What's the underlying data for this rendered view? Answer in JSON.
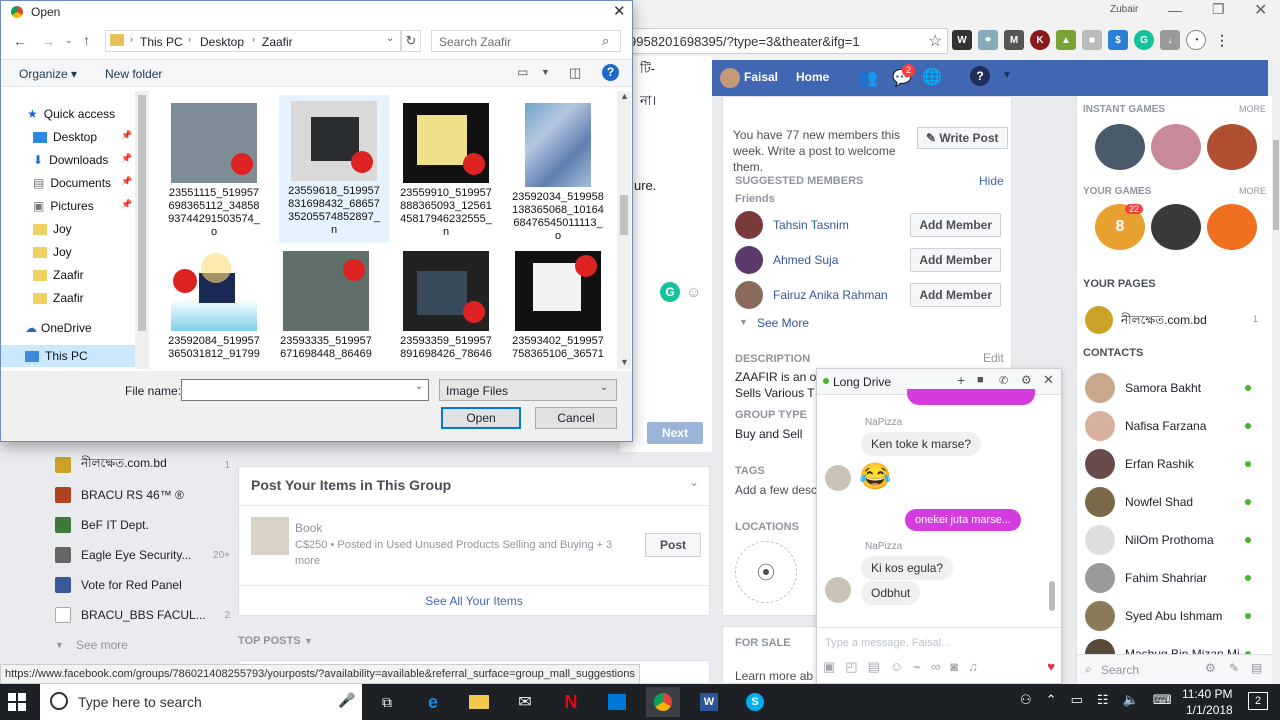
{
  "browser": {
    "user_name": "Zubair",
    "url": "9958201698395/?type=3&theater&ifg=1",
    "status_url": "https://www.facebook.com/groups/786021408255793/yourposts/?availability=available&referral_surface=group_mall_suggestions"
  },
  "dialog": {
    "title": "Open",
    "breadcrumb": [
      "This PC",
      "Desktop",
      "Zaafir"
    ],
    "search_placeholder": "Search Zaafir",
    "organize_label": "Organize",
    "new_folder_label": "New folder",
    "nav_items": [
      {
        "label": "Quick access",
        "icon": "star-icon"
      },
      {
        "label": "Desktop",
        "icon": "desktop-icon"
      },
      {
        "label": "Downloads",
        "icon": "download-icon"
      },
      {
        "label": "Documents",
        "icon": "document-icon"
      },
      {
        "label": "Pictures",
        "icon": "pictures-icon"
      },
      {
        "label": "Joy",
        "icon": "folder-icon"
      },
      {
        "label": "Joy",
        "icon": "folder-icon"
      },
      {
        "label": "Zaafir",
        "icon": "folder-icon"
      },
      {
        "label": "Zaafir",
        "icon": "folder-icon"
      },
      {
        "label": "OneDrive",
        "icon": "cloud-icon"
      },
      {
        "label": "This PC",
        "icon": "computer-icon"
      }
    ],
    "files": [
      {
        "name": "23551115_519957698365112_3485893744291503574_o",
        "lines": [
          "23551115_519957",
          "698365112_34858",
          "93744291503574_",
          "o"
        ]
      },
      {
        "name": "23559618_519957831698432_6865735205574852897_n",
        "lines": [
          "23559618_519957",
          "831698432_68657",
          "35205574852897_",
          "n"
        ]
      },
      {
        "name": "23559910_519957888365093_1256145817946232555_n",
        "lines": [
          "23559910_519957",
          "888365093_12561",
          "45817946232555_",
          "n"
        ]
      },
      {
        "name": "23592034_519958138365068_1016468476545011113_o",
        "lines": [
          "23592034_519958",
          "138365068_10164",
          "68476545011113_",
          "o"
        ]
      },
      {
        "name": "23592084_519957365031812_91799",
        "lines": [
          "23592084_519957",
          "365031812_91799"
        ]
      },
      {
        "name": "23593335_519957671698448_86469",
        "lines": [
          "23593335_519957",
          "671698448_86469"
        ]
      },
      {
        "name": "23593359_519957891698426_78646",
        "lines": [
          "23593359_519957",
          "891698426_78646"
        ]
      },
      {
        "name": "23593402_519957758365106_36571",
        "lines": [
          "23593402_519957",
          "758365106_36571"
        ]
      }
    ],
    "file_name_label": "File name:",
    "file_name_value": "",
    "file_type": "Image Files",
    "open_label": "Open",
    "cancel_label": "Cancel"
  },
  "facebook": {
    "nav": {
      "profile": "Faisal",
      "home": "Home",
      "badge": "2"
    },
    "new_members_text": "You have 77 new members this week. Write a post to welcome them.",
    "write_post": "Write Post",
    "suggested_members": "SUGGESTED MEMBERS",
    "hide": "Hide",
    "friends": "Friends",
    "members": [
      "Tahsin Tasnim",
      "Ahmed Suja",
      "Fairuz Anika Rahman"
    ],
    "add_member": "Add Member",
    "see_more": "See More",
    "description": "DESCRIPTION",
    "edit": "Edit",
    "description_text": "ZAAFIR is an o",
    "description_text2": "Sells Various T",
    "group_type_label": "GROUP TYPE",
    "group_type": "Buy and Sell",
    "tags": "TAGS",
    "add_desc": "Add a few desc",
    "locations": "LOCATIONS",
    "for_sale": "FOR SALE",
    "learn_more": "Learn more ab",
    "next": "Next",
    "instant_games": "INSTANT GAMES",
    "more": "MORE",
    "your_games": "YOUR GAMES",
    "game_badge": "22",
    "your_pages": "YOUR PAGES",
    "page_name": "নীলক্ষেত.com.bd",
    "page_count": "1",
    "contacts_label": "CONTACTS",
    "contacts": [
      "Samora Bakht",
      "Nafisa Farzana",
      "Erfan Rashik",
      "Nowfel Shad",
      "NilOm Prothoma",
      "Fahim Shahriar",
      "Syed Abu Ishmam",
      "Mashuq Bin Mizan Mi"
    ],
    "search": "Search",
    "left_groups": [
      {
        "label": "নীলক্ষেত.com.bd",
        "count": "1",
        "color": "#c9a227"
      },
      {
        "label": "BRACU RS 46™ ®",
        "count": "",
        "color": "#b0421f"
      },
      {
        "label": "BeF IT Dept.",
        "count": "",
        "color": "#3c7a3a"
      },
      {
        "label": "Eagle Eye Security...",
        "count": "20+",
        "color": "#666"
      },
      {
        "label": "Vote for Red Panel",
        "count": "",
        "color": "#3b5998"
      },
      {
        "label": "BRACU_BBS FACUL...",
        "count": "2",
        "color": "#aaa"
      }
    ],
    "left_see_more": "See more",
    "top_posts": "TOP POSTS",
    "post_items_title": "Post Your Items in This Group",
    "item_title": "Book",
    "item_meta": "C$250 • Posted in Used Unused Products Selling and Buying + 3 more",
    "post_label": "Post",
    "see_all_items": "See All Your Items",
    "bg_text_1": "টি-",
    "bg_text_2": "না।",
    "bg_text_3": "ure.",
    "chat": {
      "title": "Long Drive",
      "sender": "NaPizza",
      "msg1": "Ken toke k marse?",
      "msg2": "onekei juta marse...",
      "msg3": "Ki kos egula?",
      "msg4": "Odbhut",
      "input_placeholder": "Type a message, Faisal..."
    }
  },
  "taskbar": {
    "search": "Type here to search",
    "time": "11:40 PM",
    "date": "1/1/2018",
    "notification_count": "2"
  }
}
